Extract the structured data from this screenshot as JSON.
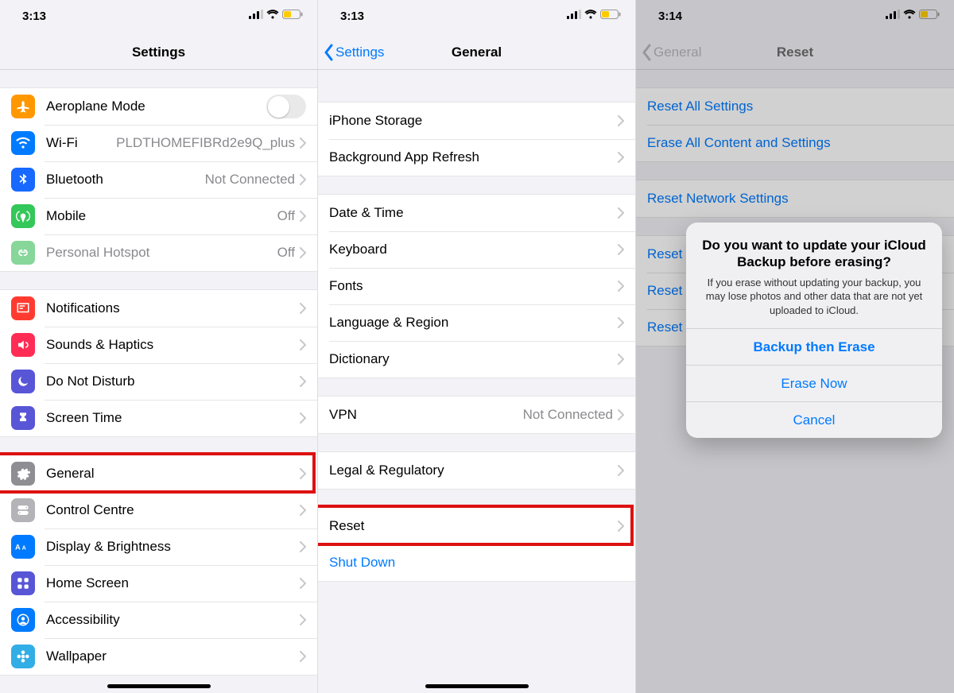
{
  "screen1": {
    "time": "3:13",
    "title": "Settings",
    "groups": [
      {
        "cells": [
          {
            "key": "aeroplane",
            "icon": "airplane",
            "bg": "bg-orange",
            "label": "Aeroplane Mode",
            "accessory": "toggle",
            "toggleOn": false
          },
          {
            "key": "wifi",
            "icon": "wifi",
            "bg": "bg-blue",
            "label": "Wi-Fi",
            "value": "PLDTHOMEFIBRd2e9Q_plus",
            "accessory": "chevron"
          },
          {
            "key": "bluetooth",
            "icon": "bluetooth",
            "bg": "bg-btblue",
            "label": "Bluetooth",
            "value": "Not Connected",
            "accessory": "chevron"
          },
          {
            "key": "mobile",
            "icon": "antenna",
            "bg": "bg-green",
            "label": "Mobile",
            "value": "Off",
            "accessory": "chevron"
          },
          {
            "key": "hotspot",
            "icon": "link",
            "bg": "bg-green2",
            "label": "Personal Hotspot",
            "value": "Off",
            "accessory": "chevron",
            "disabled": true
          }
        ]
      },
      {
        "cells": [
          {
            "key": "notifications",
            "icon": "bell",
            "bg": "bg-red",
            "label": "Notifications",
            "accessory": "chevron"
          },
          {
            "key": "sounds",
            "icon": "speaker",
            "bg": "bg-pink",
            "label": "Sounds & Haptics",
            "accessory": "chevron"
          },
          {
            "key": "dnd",
            "icon": "moon",
            "bg": "bg-indigo",
            "label": "Do Not Disturb",
            "accessory": "chevron"
          },
          {
            "key": "screentime",
            "icon": "hourglass",
            "bg": "bg-indigo",
            "label": "Screen Time",
            "accessory": "chevron"
          }
        ]
      },
      {
        "cells": [
          {
            "key": "general",
            "icon": "gear",
            "bg": "bg-gray",
            "label": "General",
            "accessory": "chevron",
            "highlight": true
          },
          {
            "key": "controlcentre",
            "icon": "switches",
            "bg": "bg-lgray",
            "label": "Control Centre",
            "accessory": "chevron"
          },
          {
            "key": "display",
            "icon": "aa",
            "bg": "bg-blue",
            "label": "Display & Brightness",
            "accessory": "chevron"
          },
          {
            "key": "homescreen",
            "icon": "grid",
            "bg": "bg-indigo",
            "label": "Home Screen",
            "accessory": "chevron"
          },
          {
            "key": "accessibility",
            "icon": "person",
            "bg": "bg-blue",
            "label": "Accessibility",
            "accessory": "chevron"
          },
          {
            "key": "wallpaper",
            "icon": "flower",
            "bg": "bg-cyan",
            "label": "Wallpaper",
            "accessory": "chevron"
          }
        ]
      }
    ]
  },
  "screen2": {
    "time": "3:13",
    "back": "Settings",
    "title": "General",
    "groups": [
      {
        "cells": [
          {
            "key": "storage",
            "label": "iPhone Storage",
            "accessory": "chevron"
          },
          {
            "key": "bgrefresh",
            "label": "Background App Refresh",
            "accessory": "chevron"
          }
        ]
      },
      {
        "cells": [
          {
            "key": "datetime",
            "label": "Date & Time",
            "accessory": "chevron"
          },
          {
            "key": "keyboard",
            "label": "Keyboard",
            "accessory": "chevron"
          },
          {
            "key": "fonts",
            "label": "Fonts",
            "accessory": "chevron"
          },
          {
            "key": "language",
            "label": "Language & Region",
            "accessory": "chevron"
          },
          {
            "key": "dictionary",
            "label": "Dictionary",
            "accessory": "chevron"
          }
        ]
      },
      {
        "cells": [
          {
            "key": "vpn",
            "label": "VPN",
            "value": "Not Connected",
            "accessory": "chevron"
          }
        ]
      },
      {
        "cells": [
          {
            "key": "legal",
            "label": "Legal & Regulatory",
            "accessory": "chevron"
          }
        ]
      },
      {
        "cells": [
          {
            "key": "reset",
            "label": "Reset",
            "accessory": "chevron",
            "highlight": true
          },
          {
            "key": "shutdown",
            "label": "Shut Down",
            "link": true
          }
        ]
      }
    ]
  },
  "screen3": {
    "time": "3:14",
    "back": "General",
    "title": "Reset",
    "groups": [
      {
        "cells": [
          {
            "key": "resetall",
            "label": "Reset All Settings",
            "link": true
          },
          {
            "key": "eraseall",
            "label": "Erase All Content and Settings",
            "link": true
          }
        ]
      },
      {
        "cells": [
          {
            "key": "resetnet",
            "label": "Reset Network Settings",
            "link": true
          }
        ]
      },
      {
        "cells": [
          {
            "key": "resetkb",
            "label": "Reset Keyboard Dictionary",
            "link": true
          },
          {
            "key": "resethome",
            "label": "Reset Home Screen Layout",
            "link": true
          },
          {
            "key": "resetloc",
            "label": "Reset Location & Privacy",
            "link": true
          }
        ]
      }
    ],
    "alert": {
      "title": "Do you want to update your iCloud Backup before erasing?",
      "message": "If you erase without updating your backup, you may lose photos and other data that are not yet uploaded to iCloud.",
      "buttons": [
        {
          "key": "backup",
          "label": "Backup then Erase",
          "primary": true
        },
        {
          "key": "erasenow",
          "label": "Erase Now",
          "highlight": true
        },
        {
          "key": "cancel",
          "label": "Cancel"
        }
      ]
    }
  }
}
